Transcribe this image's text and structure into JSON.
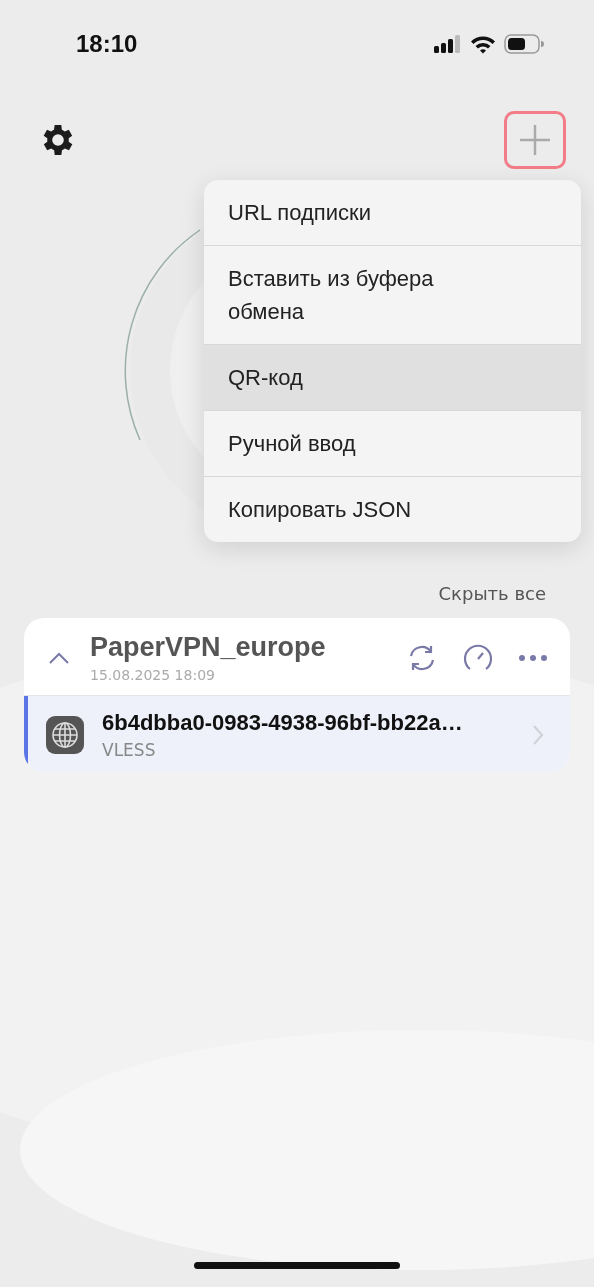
{
  "status_bar": {
    "time": "18:10"
  },
  "menu": {
    "items": [
      {
        "label": "URL подписки",
        "selected": false
      },
      {
        "label": "Вставить из буфера обмена",
        "selected": false
      },
      {
        "label": "QR-код",
        "selected": true
      },
      {
        "label": "Ручной ввод",
        "selected": false
      },
      {
        "label": "Копировать JSON",
        "selected": false
      }
    ]
  },
  "hide_all": "Скрыть все",
  "group": {
    "name": "PaperVPN_europe",
    "date": "15.08.2025 18:09",
    "expanded": true,
    "servers": [
      {
        "name": "6b4dbba0-0983-4938-96bf-bb22a…",
        "protocol": "VLESS",
        "selected": true
      }
    ]
  }
}
